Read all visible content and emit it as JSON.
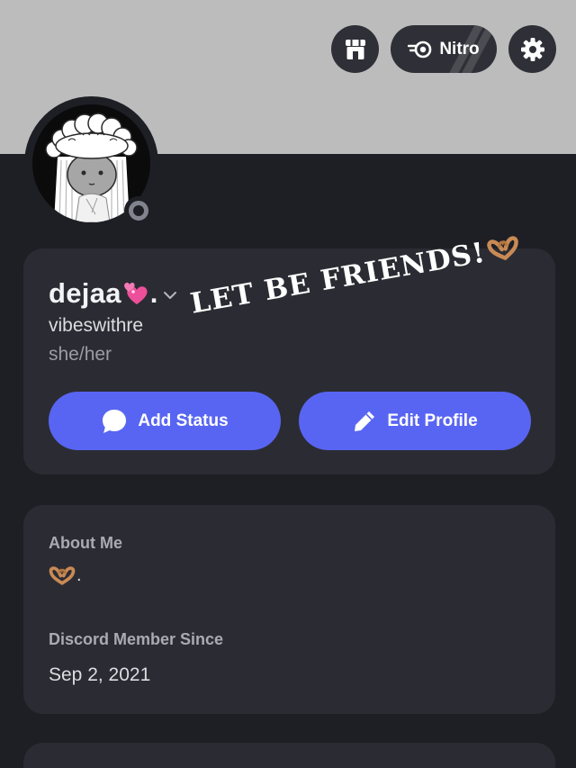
{
  "header": {
    "shop_icon": "shop-icon",
    "nitro_label": "Nitro",
    "nitro_icon": "nitro-icon",
    "settings_icon": "gear-icon"
  },
  "profile": {
    "display_name": "dejaa",
    "display_name_emoji": "two-hearts-emoji",
    "display_name_suffix": ".",
    "username": "vibeswithre",
    "pronouns": "she/her",
    "status": "offline",
    "overlay_text": "LET BE FRIENDS!",
    "overlay_emoji": "heart-hands-emoji"
  },
  "actions": {
    "add_status_label": "Add Status",
    "edit_profile_label": "Edit Profile"
  },
  "about": {
    "heading": "About Me",
    "body_emoji": "heart-hands-emoji",
    "body_text": ".",
    "member_since_heading": "Discord Member Since",
    "member_since_date": "Sep 2, 2021"
  },
  "colors": {
    "banner": "#bcbcbc",
    "background": "#1e1f25",
    "card": "#2b2c33",
    "accent": "#5865f2",
    "status_offline": "#81848e"
  }
}
